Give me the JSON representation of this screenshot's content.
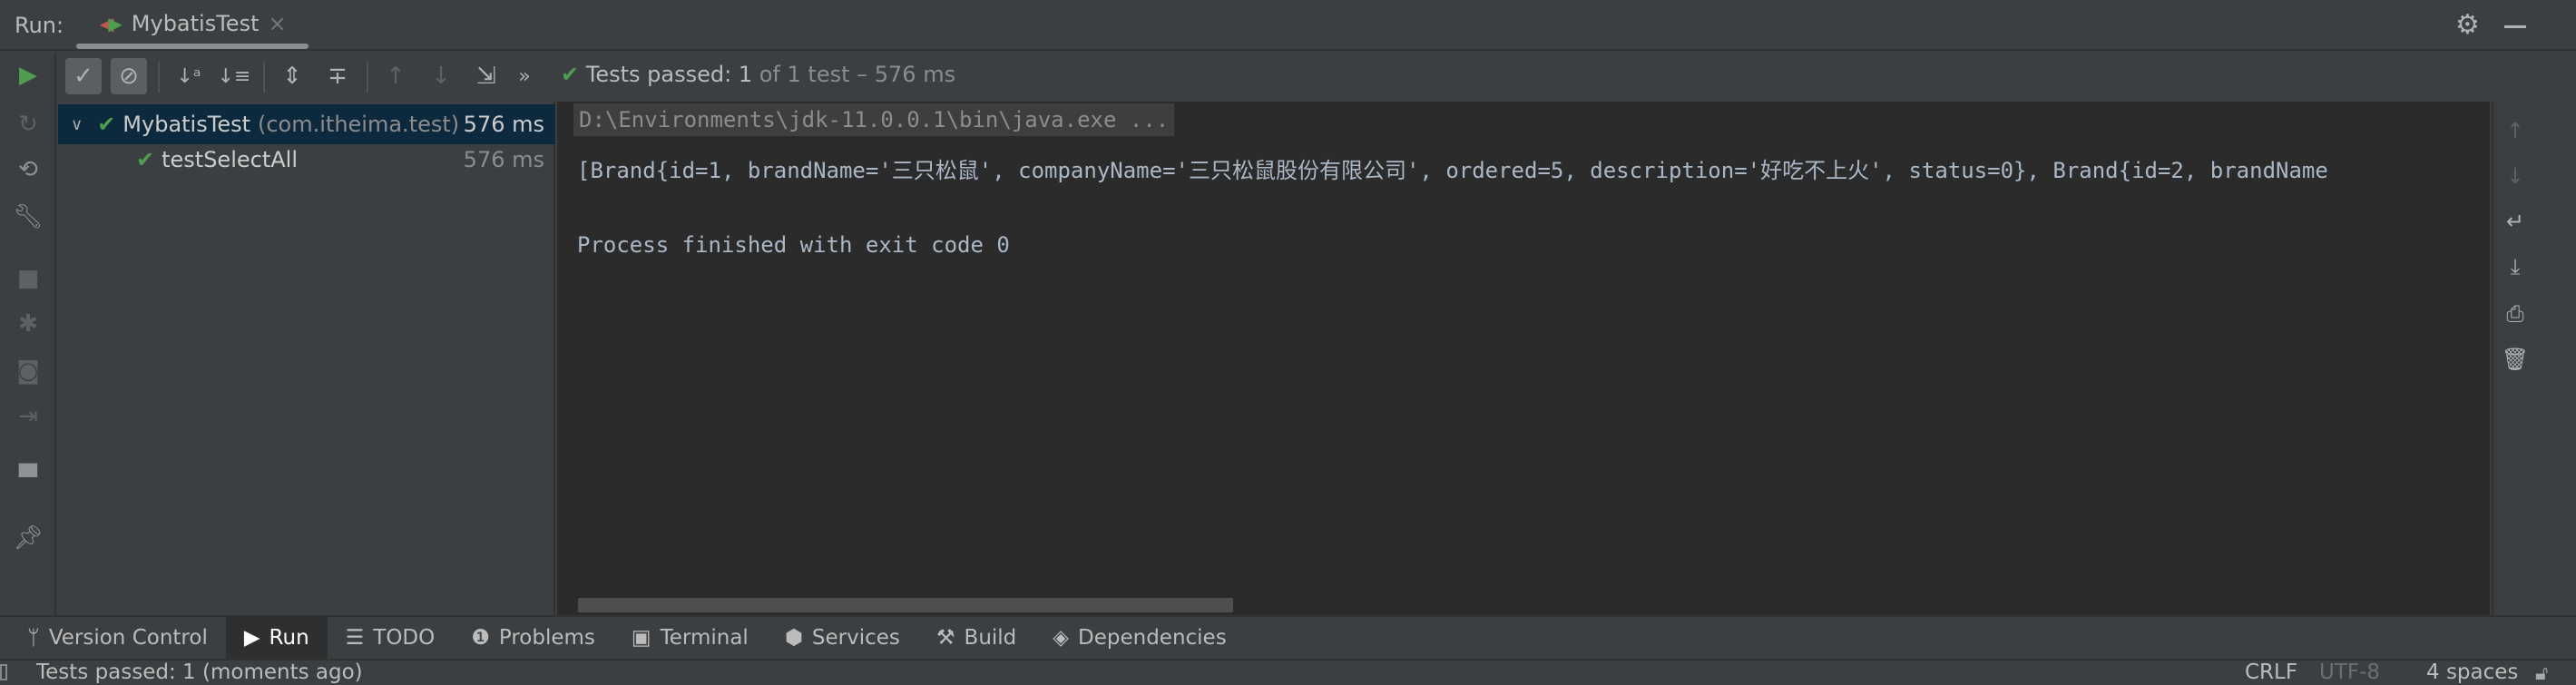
{
  "run_panel": {
    "label": "Run:",
    "tab": {
      "title": "MybatisTest",
      "close": "×"
    }
  },
  "toolbar": {
    "status_check": "✔",
    "status_passed": "Tests passed:",
    "status_count": "1",
    "status_rest": "of 1 test – 576 ms",
    "more": "»"
  },
  "tree": {
    "items": [
      {
        "name": "MybatisTest",
        "detail": "(com.itheima.test)",
        "time": "576 ms",
        "status": "passed",
        "expanded": true
      },
      {
        "name": "testSelectAll",
        "time": "576 ms",
        "status": "passed"
      }
    ]
  },
  "console": {
    "lines": [
      "D:\\Environments\\jdk-11.0.0.1\\bin\\java.exe ...",
      "[Brand{id=1, brandName='三只松鼠', companyName='三只松鼠股份有限公司', ordered=5, description='好吃不上火', status=0}, Brand{id=2, brandName",
      "",
      "Process finished with exit code 0"
    ]
  },
  "tool_windows": [
    {
      "label": "Version Control",
      "icon": "vcs-branch-icon"
    },
    {
      "label": "Run",
      "icon": "run-icon",
      "active": true
    },
    {
      "label": "TODO",
      "icon": "list-icon"
    },
    {
      "label": "Problems",
      "icon": "warning-icon"
    },
    {
      "label": "Terminal",
      "icon": "terminal-icon"
    },
    {
      "label": "Services",
      "icon": "services-icon"
    },
    {
      "label": "Build",
      "icon": "hammer-icon"
    },
    {
      "label": "Dependencies",
      "icon": "dependencies-icon"
    }
  ],
  "statusbar": {
    "message": "Tests passed: 1 (moments ago)",
    "line_sep": "CRLF",
    "encoding": "UTF-8",
    "indent": "4 spaces"
  },
  "colors": {
    "pass": "#4f9e4f",
    "console_bg": "#2b2b2b",
    "panel_bg": "#3c3f41",
    "selection": "#0d293e"
  }
}
